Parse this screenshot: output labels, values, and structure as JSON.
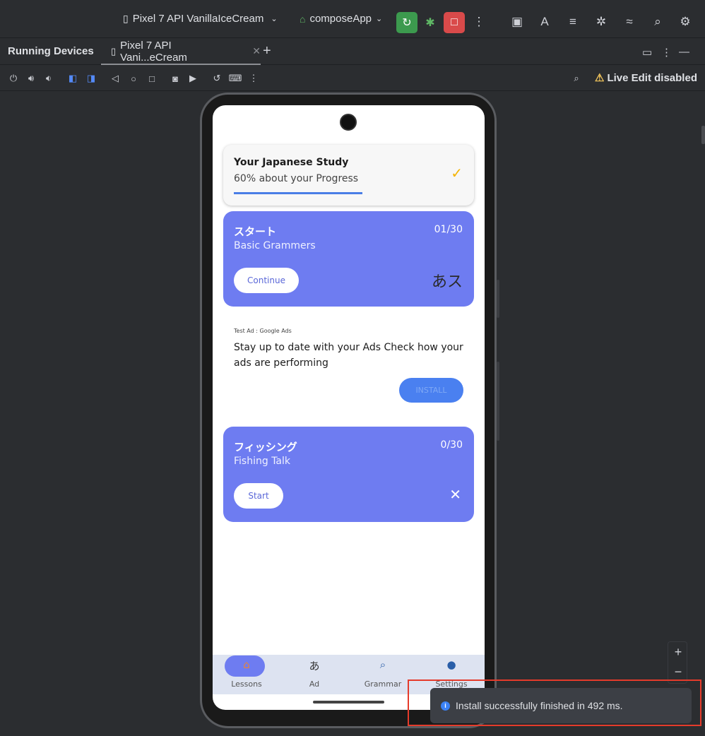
{
  "toolbar": {
    "device": "Pixel 7 API VanillaIceCream",
    "app": "composeApp"
  },
  "tabs": {
    "panel_title": "Running Devices",
    "device_tab": "Pixel 7 API Vani...eCream"
  },
  "device_toolbar": {
    "live_edit": "Live Edit disabled"
  },
  "app_screen": {
    "progress": {
      "title": "Your Japanese Study",
      "subtitle": "60% about your Progress",
      "percent": 60
    },
    "lessons": [
      {
        "title_jp": "スタート",
        "title_en": "Basic Grammers",
        "count": "01/30",
        "button": "Continue",
        "mark": "あス"
      },
      {
        "title_jp": "フィッシング",
        "title_en": "Fishing Talk",
        "count": "0/30",
        "button": "Start",
        "mark": "✕"
      }
    ],
    "ad": {
      "label": "Test Ad : Google Ads",
      "text": "Stay up to date with your Ads Check how your ads are performing",
      "button": "INSTALL"
    },
    "nav": [
      {
        "label": "Lessons",
        "icon": "home-icon",
        "active": true
      },
      {
        "label": "Ad",
        "icon": "hiragana-a-icon",
        "active": false
      },
      {
        "label": "Grammar",
        "icon": "search-icon",
        "active": false
      },
      {
        "label": "Settings",
        "icon": "person-icon",
        "active": false
      }
    ]
  },
  "notification": {
    "message": "Install successfully finished in 492 ms."
  },
  "colors": {
    "accent": "#6e7cf1",
    "highlight": "#e53b2b",
    "run_button": "#3c9a4e",
    "stop_button": "#d94a4a"
  }
}
